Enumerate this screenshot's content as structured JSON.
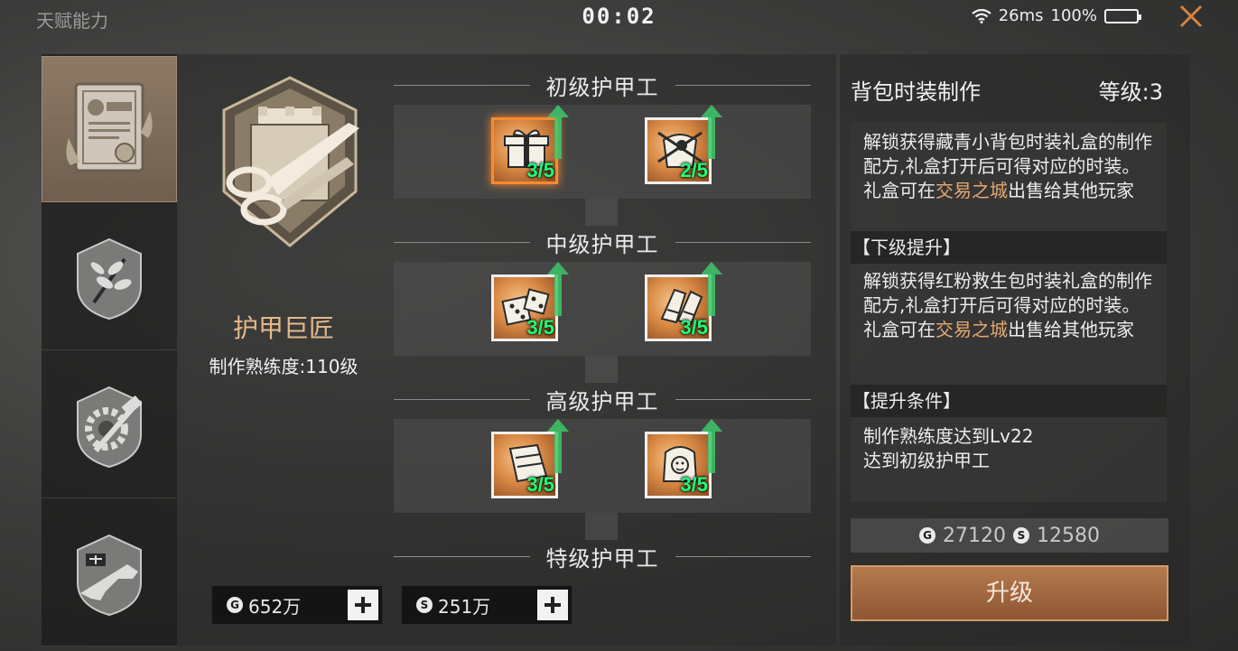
{
  "header": {
    "page_title": "天赋能力",
    "timer": "00:02",
    "ping": "26ms",
    "battery": "100%"
  },
  "sidebar": {
    "items": [
      {
        "name": "trade-certificate",
        "active": true
      },
      {
        "name": "herb-badge",
        "active": false
      },
      {
        "name": "gear-hammer-badge",
        "active": false
      },
      {
        "name": "gun-badge",
        "active": false
      }
    ]
  },
  "talent": {
    "name": "护甲巨匠",
    "proficiency": "制作熟练度:110级"
  },
  "tiers": [
    {
      "label": "初级护甲工",
      "skills": [
        {
          "level": "3/5",
          "icon": "gift-box-icon",
          "selected": true
        },
        {
          "level": "2/5",
          "icon": "bag-icon",
          "selected": false
        }
      ]
    },
    {
      "label": "中级护甲工",
      "skills": [
        {
          "level": "3/5",
          "icon": "dice-icon",
          "selected": false
        },
        {
          "level": "3/5",
          "icon": "gloves-icon",
          "selected": false
        }
      ]
    },
    {
      "label": "高级护甲工",
      "skills": [
        {
          "level": "3/5",
          "icon": "cloth-icon",
          "selected": false
        },
        {
          "level": "3/5",
          "icon": "backpack-icon",
          "selected": false
        }
      ]
    },
    {
      "label": "特级护甲工",
      "skills": []
    }
  ],
  "currency": {
    "gold": "652万",
    "silver": "251万"
  },
  "detail": {
    "title": "背包时装制作",
    "level": "等级:3",
    "current_desc_a": "解锁获得藏青小背包时装礼盒的制作配方,礼盒打开后可得对应的时装。礼盒可在",
    "current_desc_link": "交易之城",
    "current_desc_b": "出售给其他玩家",
    "next_head": "【下级提升】",
    "next_desc_a": "解锁获得红粉救生包时装礼盒的制作配方,礼盒打开后可得对应的时装。礼盒可在",
    "next_desc_link": "交易之城",
    "next_desc_b": "出售给其他玩家",
    "cond_head": "【提升条件】",
    "cond_1": "制作熟练度达到Lv22",
    "cond_2": "达到初级护甲工",
    "cost_gold": "27120",
    "cost_silver": "12580",
    "upgrade_label": "升级"
  },
  "colors": {
    "accent_orange": "#ff8a30",
    "level_green": "#1aff7a",
    "highlight": "#e4a870",
    "button": "#a06a42"
  }
}
